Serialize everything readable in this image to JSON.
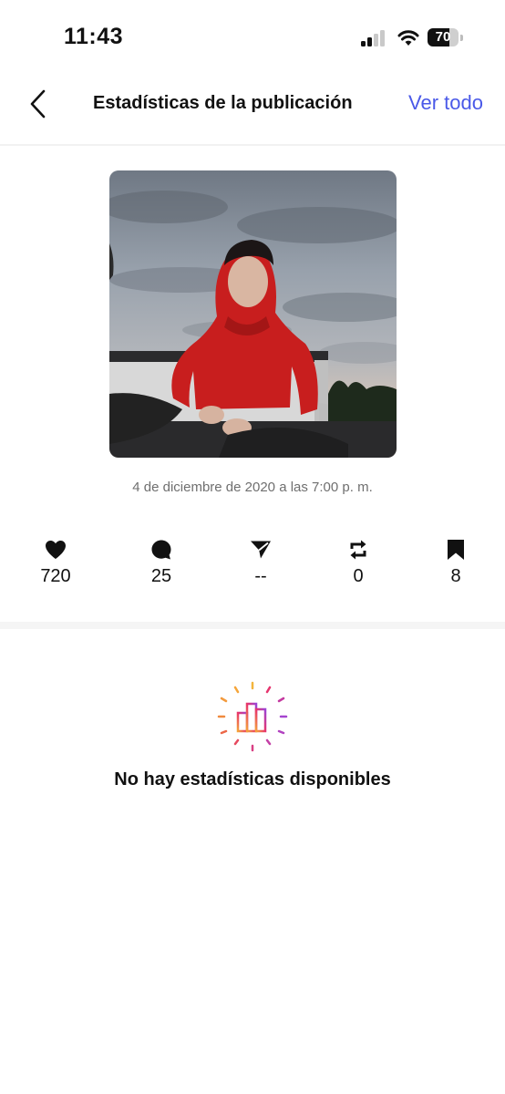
{
  "status_bar": {
    "time": "11:43",
    "battery": "70",
    "battery_level": 0.7
  },
  "header": {
    "title": "Estadísticas de la publicación",
    "action": "Ver todo"
  },
  "post": {
    "date": "4 de diciembre de 2020 a las 7:00 p. m."
  },
  "metrics": [
    {
      "icon": "heart-icon",
      "value": "720"
    },
    {
      "icon": "comment-icon",
      "value": "25"
    },
    {
      "icon": "share-icon",
      "value": "--"
    },
    {
      "icon": "repost-icon",
      "value": "0"
    },
    {
      "icon": "bookmark-icon",
      "value": "8"
    }
  ],
  "empty_state": {
    "icon": "bar-chart-icon",
    "message": "No hay estadísticas disponibles"
  },
  "colors": {
    "accent": "#4a59e8",
    "photo_hoodie": "#c81e1e",
    "photo_sky": "#aab3bd"
  }
}
